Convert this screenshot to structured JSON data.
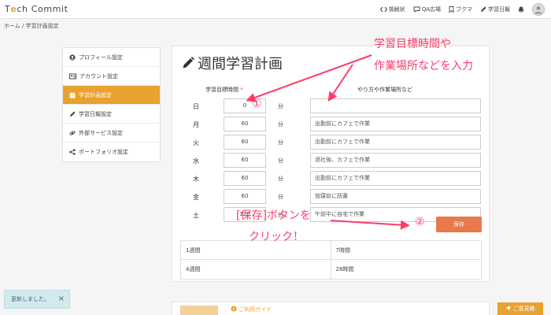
{
  "header": {
    "logo": {
      "part1": "T",
      "part2": "e",
      "part3": "ch Commit"
    },
    "nav": [
      {
        "label": "挑戦状",
        "icon": "code-icon"
      },
      {
        "label": "QA広場",
        "icon": "chat-icon"
      },
      {
        "label": "ブクマ",
        "icon": "bookmark-icon"
      },
      {
        "label": "学習日報",
        "icon": "pencil-icon"
      }
    ]
  },
  "breadcrumb": "ホーム / 学習計画設定",
  "sidebar": {
    "items": [
      {
        "label": "プロフィール設定",
        "icon": "user-icon"
      },
      {
        "label": "アカウント設定",
        "icon": "id-card-icon"
      },
      {
        "label": "学習計画設定",
        "icon": "calendar-icon",
        "active": true
      },
      {
        "label": "学習日報設定",
        "icon": "pencil-icon"
      },
      {
        "label": "外部サービス設定",
        "icon": "link-icon"
      },
      {
        "label": "ポートフォリオ設定",
        "icon": "share-icon"
      }
    ]
  },
  "main": {
    "title": "週間学習計画",
    "col_hours_label": "学習目標時間",
    "col_hours_required": "*",
    "col_place_label": "やり方や作業場所など",
    "unit": "分",
    "rows": [
      {
        "day": "日",
        "hours": "0",
        "place": ""
      },
      {
        "day": "月",
        "hours": "60",
        "place": "出勤前にカフェで作業"
      },
      {
        "day": "火",
        "hours": "60",
        "place": "出勤前にカフェで作業"
      },
      {
        "day": "水",
        "hours": "60",
        "place": "退社後、カフェで作業"
      },
      {
        "day": "木",
        "hours": "60",
        "place": "出勤前にカフェで作業"
      },
      {
        "day": "金",
        "hours": "60",
        "place": "就寝前に読書"
      },
      {
        "day": "土",
        "hours": "120",
        "place": "午前中に自宅で作業"
      }
    ],
    "save_label": "保存",
    "summary": [
      {
        "label": "1週間",
        "value": "7時間"
      },
      {
        "label": "4週間",
        "value": "28時間"
      }
    ]
  },
  "annotations": {
    "top_line1": "学習目標時間や",
    "top_line2": "作業場所などを入力",
    "num1": "①",
    "num2": "②",
    "bottom_line1": "[保存]ボタンを",
    "bottom_line2": "クリック！",
    "color": "#ff3b6a"
  },
  "toast": {
    "message": "更新しました。",
    "close": "×"
  },
  "guide": {
    "title": "ご利用ガイド"
  },
  "opinion_label": "ご意見箱",
  "colors": {
    "accent": "#e8a22f",
    "save": "#e8794a"
  }
}
